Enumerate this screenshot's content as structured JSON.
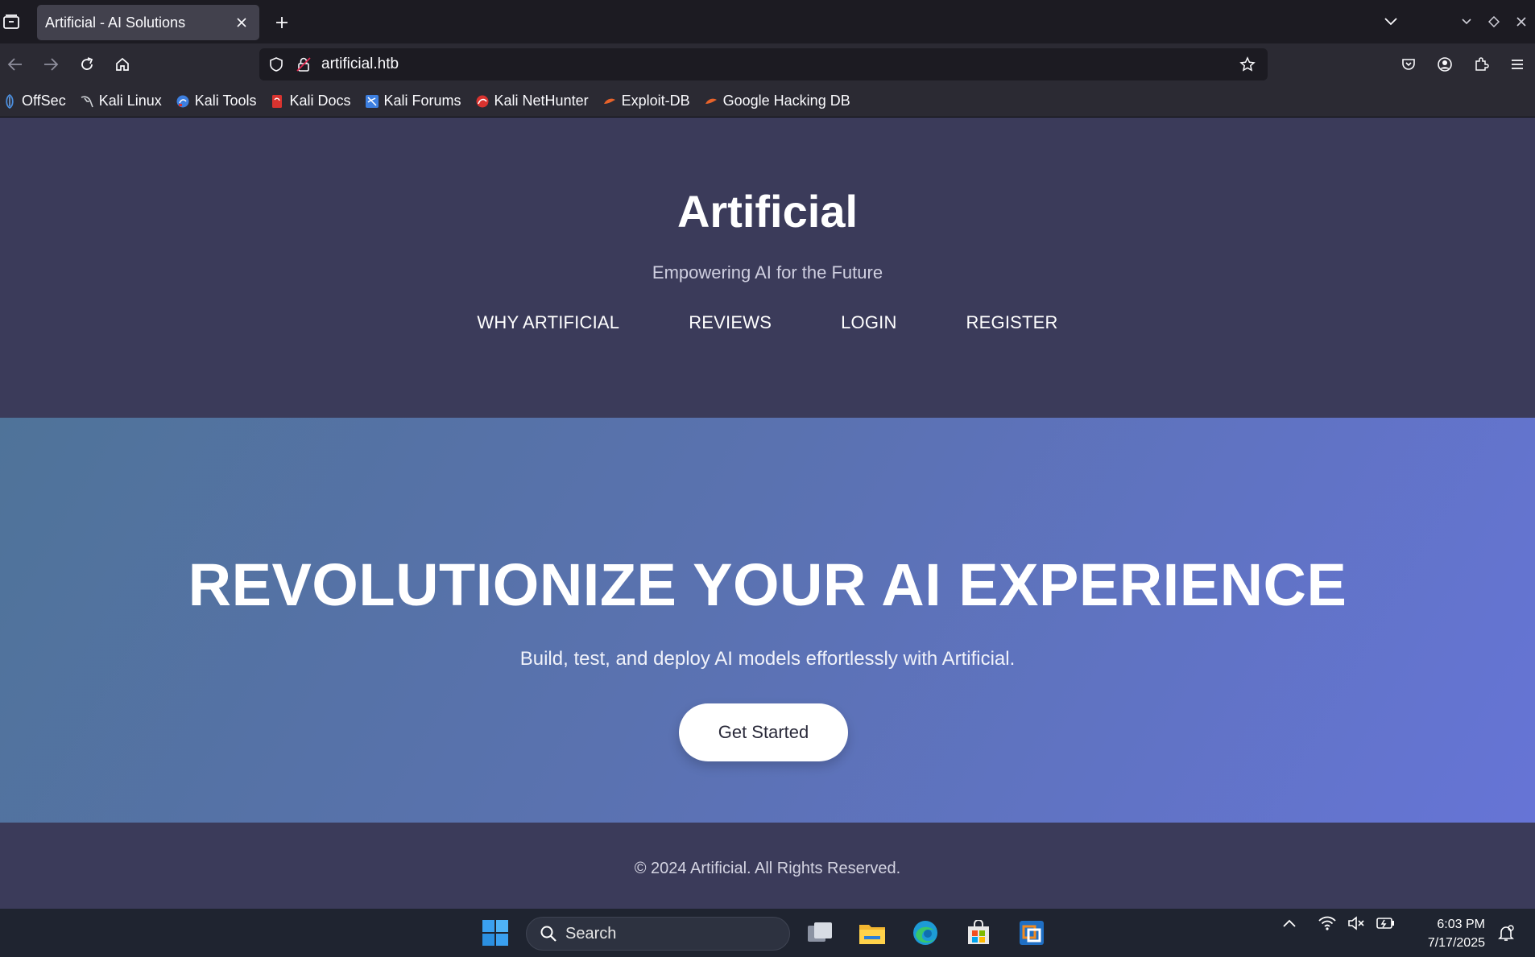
{
  "browser": {
    "tab_title": "Artificial - AI Solutions",
    "url": "artificial.htb",
    "bookmarks": [
      {
        "label": "OffSec",
        "icon": "offsec-icon",
        "color": "#4a8fe0"
      },
      {
        "label": "Kali Linux",
        "icon": "kali-dragon-icon",
        "color": "#cfd2d6"
      },
      {
        "label": "Kali Tools",
        "icon": "kali-tools-icon",
        "color": "#3d7fe0"
      },
      {
        "label": "Kali Docs",
        "icon": "kali-docs-icon",
        "color": "#d9332f"
      },
      {
        "label": "Kali Forums",
        "icon": "kali-forums-icon",
        "color": "#3d7fe0"
      },
      {
        "label": "Kali NetHunter",
        "icon": "nethunter-icon",
        "color": "#d9332f"
      },
      {
        "label": "Exploit-DB",
        "icon": "exploit-db-icon",
        "color": "#e8632a"
      },
      {
        "label": "Google Hacking DB",
        "icon": "ghdb-icon",
        "color": "#e8632a"
      }
    ]
  },
  "site": {
    "title": "Artificial",
    "tagline": "Empowering AI for the Future",
    "nav": [
      "WHY ARTIFICIAL",
      "REVIEWS",
      "LOGIN",
      "REGISTER"
    ],
    "hero_title": "REVOLUTIONIZE YOUR AI EXPERIENCE",
    "hero_subtitle": "Build, test, and deploy AI models effortlessly with Artificial.",
    "cta": "Get Started",
    "footer": "© 2024 Artificial. All Rights Reserved."
  },
  "taskbar": {
    "search_label": "Search",
    "time": "6:03 PM",
    "date": "7/17/2025"
  }
}
